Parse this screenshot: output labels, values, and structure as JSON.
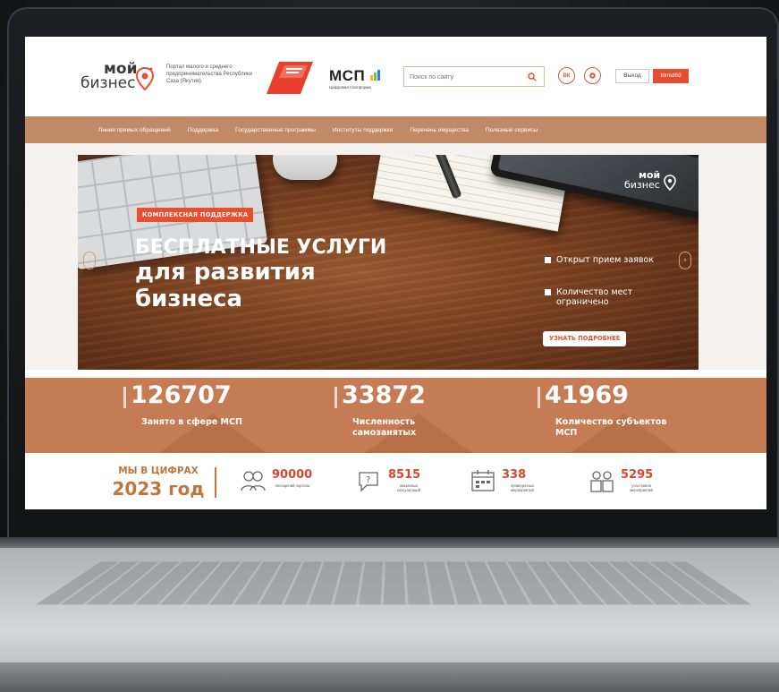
{
  "header": {
    "logo_word1": "мой",
    "logo_word2": "бизнес",
    "portal_text": "Портал малого и среднего предпринимательства Республики Саха (Якутия)",
    "msp_logo": "МСП",
    "msp_sub": "Цифровая платформа",
    "search_placeholder": "Поиск по сайту",
    "vk_label": "ВК",
    "exit_label": "Выход",
    "user_label": "trimid69"
  },
  "nav": {
    "items": [
      "Линия прямых обращений",
      "Поддержка",
      "Государственные программы",
      "Институты поддержки",
      "Перечень имущества",
      "Полезные сервисы"
    ]
  },
  "hero": {
    "tag": "КОМПЛЕКСНАЯ ПОДДЕРЖКА",
    "title1": "БЕСПЛАТНЫЕ УСЛУГИ",
    "title2": "для развития бизнеса",
    "logo_word1": "мой",
    "logo_word2": "бизнес",
    "bullet1": "Открыт прием заявок",
    "bullet2": "Количество мест ограничено",
    "button": "УЗНАТЬ ПОДРОБНЕЕ"
  },
  "stats": [
    {
      "value": "126707",
      "label": "Занято в сфере МСП"
    },
    {
      "value": "33872",
      "label": "Численность самозанятых"
    },
    {
      "value": "41969",
      "label": "Количество субъектов МСП"
    }
  ],
  "figures": {
    "title": "МЫ В ЦИФРАХ",
    "year": "2023 год",
    "items": [
      {
        "value": "90000",
        "caption": "посещений портала",
        "icon": "visitors-icon"
      },
      {
        "value": "8515",
        "caption": "оказанных консультаций",
        "icon": "consultation-icon"
      },
      {
        "value": "338",
        "caption": "проведенных мероприятий",
        "icon": "calendar-icon"
      },
      {
        "value": "5295",
        "caption": "участников мероприятий",
        "icon": "participants-icon"
      }
    ]
  },
  "colors": {
    "brand_orange": "#e8502d",
    "nav_brown": "#c08a66",
    "stats_bg": "#c57b53",
    "accent_text": "#c0753d"
  }
}
